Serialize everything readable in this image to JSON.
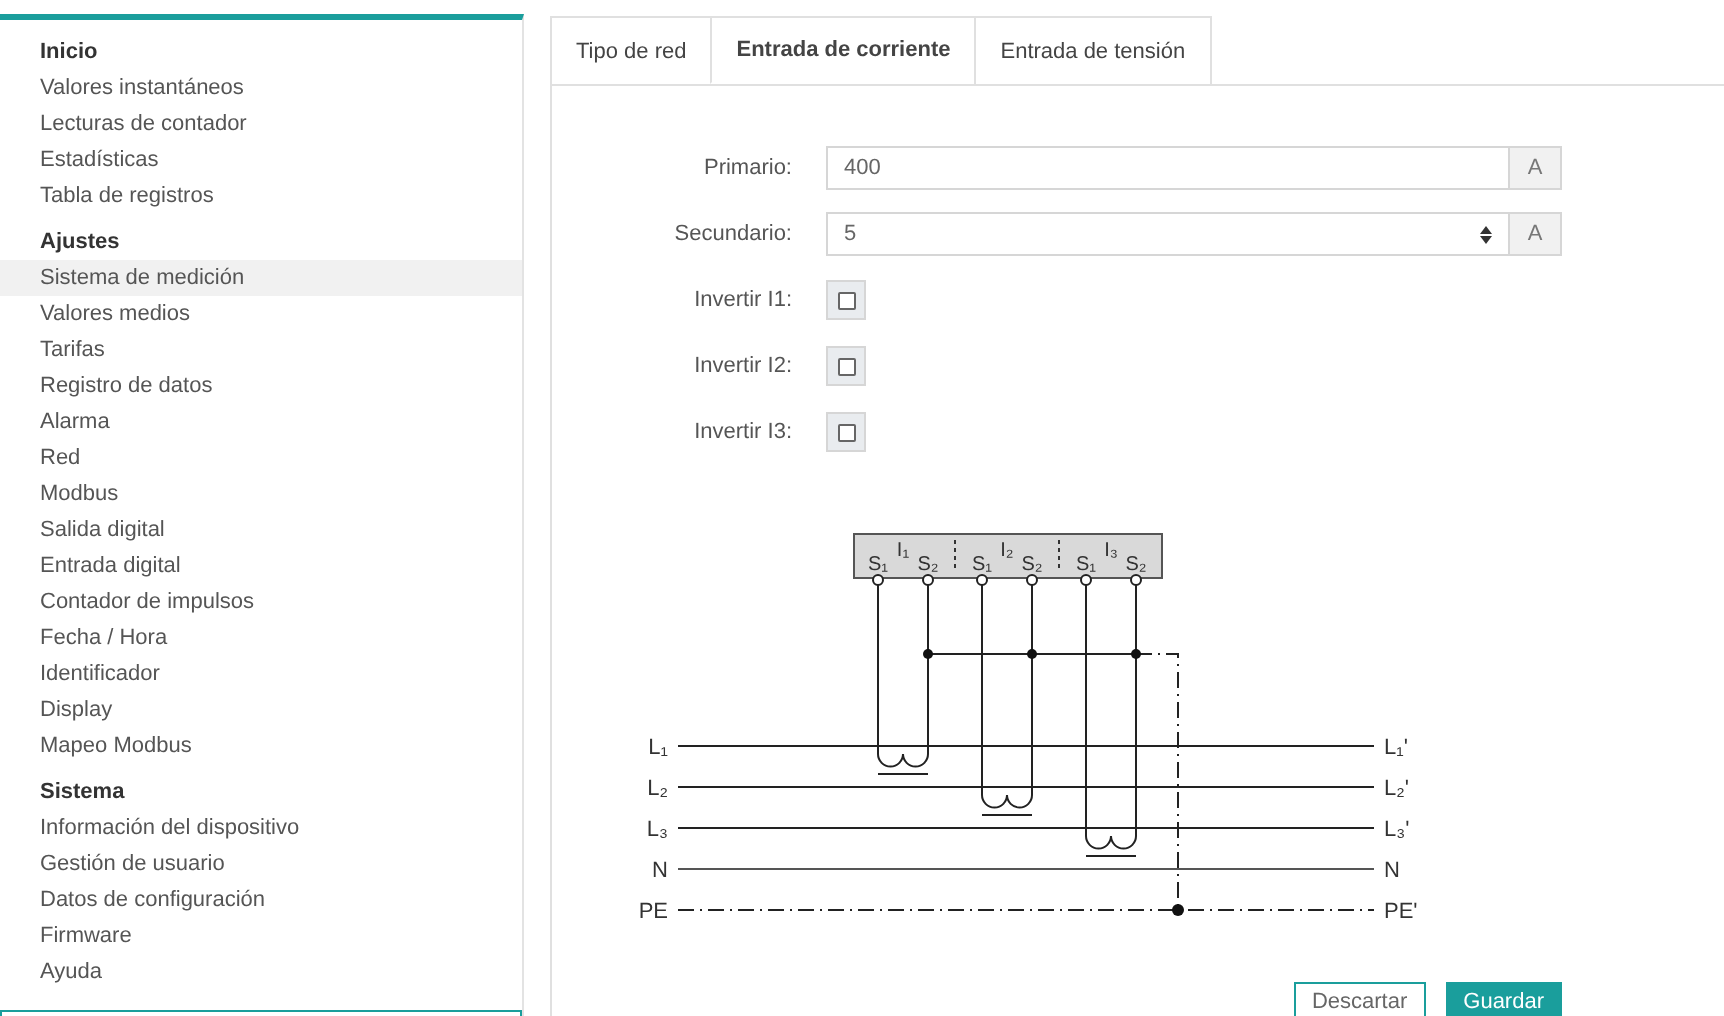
{
  "sidebar": {
    "sections": [
      {
        "title": "Inicio",
        "items": [
          {
            "label": "Valores instantáneos",
            "selected": false
          },
          {
            "label": "Lecturas de contador",
            "selected": false
          },
          {
            "label": "Estadísticas",
            "selected": false
          },
          {
            "label": "Tabla de registros",
            "selected": false
          }
        ]
      },
      {
        "title": "Ajustes",
        "items": [
          {
            "label": "Sistema de medición",
            "selected": true
          },
          {
            "label": "Valores medios",
            "selected": false
          },
          {
            "label": "Tarifas",
            "selected": false
          },
          {
            "label": "Registro de datos",
            "selected": false
          },
          {
            "label": "Alarma",
            "selected": false
          },
          {
            "label": "Red",
            "selected": false
          },
          {
            "label": "Modbus",
            "selected": false
          },
          {
            "label": "Salida digital",
            "selected": false
          },
          {
            "label": "Entrada digital",
            "selected": false
          },
          {
            "label": "Contador de impulsos",
            "selected": false
          },
          {
            "label": "Fecha / Hora",
            "selected": false
          },
          {
            "label": "Identificador",
            "selected": false
          },
          {
            "label": "Display",
            "selected": false
          },
          {
            "label": "Mapeo Modbus",
            "selected": false
          }
        ]
      },
      {
        "title": "Sistema",
        "items": [
          {
            "label": "Información del dispositivo",
            "selected": false
          },
          {
            "label": "Gestión de usuario",
            "selected": false
          },
          {
            "label": "Datos de configuración",
            "selected": false
          },
          {
            "label": "Firmware",
            "selected": false
          },
          {
            "label": "Ayuda",
            "selected": false
          }
        ]
      }
    ]
  },
  "tabs": [
    {
      "label": "Tipo de red",
      "selected": false
    },
    {
      "label": "Entrada de corriente",
      "selected": true
    },
    {
      "label": "Entrada de tensión",
      "selected": false
    }
  ],
  "fields": [
    {
      "kind": "text",
      "label": "Primario:",
      "value": "400",
      "unit": "A"
    },
    {
      "kind": "select",
      "label": "Secundario:",
      "value": "5",
      "unit": "A"
    },
    {
      "kind": "checkbox",
      "label": "Invertir I1:",
      "checked": false
    },
    {
      "kind": "checkbox",
      "label": "Invertir I2:",
      "checked": false
    },
    {
      "kind": "checkbox",
      "label": "Invertir I3:",
      "checked": false
    }
  ],
  "diagram": {
    "terminals": [
      {
        "name": "I₁",
        "s1": "S₁",
        "s2": "S₂"
      },
      {
        "name": "I₂",
        "s1": "S₁",
        "s2": "S₂"
      },
      {
        "name": "I₃",
        "s1": "S₁",
        "s2": "S₂"
      }
    ],
    "lines": [
      {
        "kind": "phase",
        "left": "L₁",
        "right": "L₁'"
      },
      {
        "kind": "phase",
        "left": "L₂",
        "right": "L₂'"
      },
      {
        "kind": "phase",
        "left": "L₃",
        "right": "L₃'"
      },
      {
        "kind": "neutral",
        "left": "N",
        "right": "N"
      },
      {
        "kind": "earth",
        "left": "PE",
        "right": "PE'"
      }
    ]
  },
  "buttons": [
    {
      "kind": "secondary",
      "label": "Descartar"
    },
    {
      "kind": "primary",
      "label": "Guardar"
    }
  ]
}
